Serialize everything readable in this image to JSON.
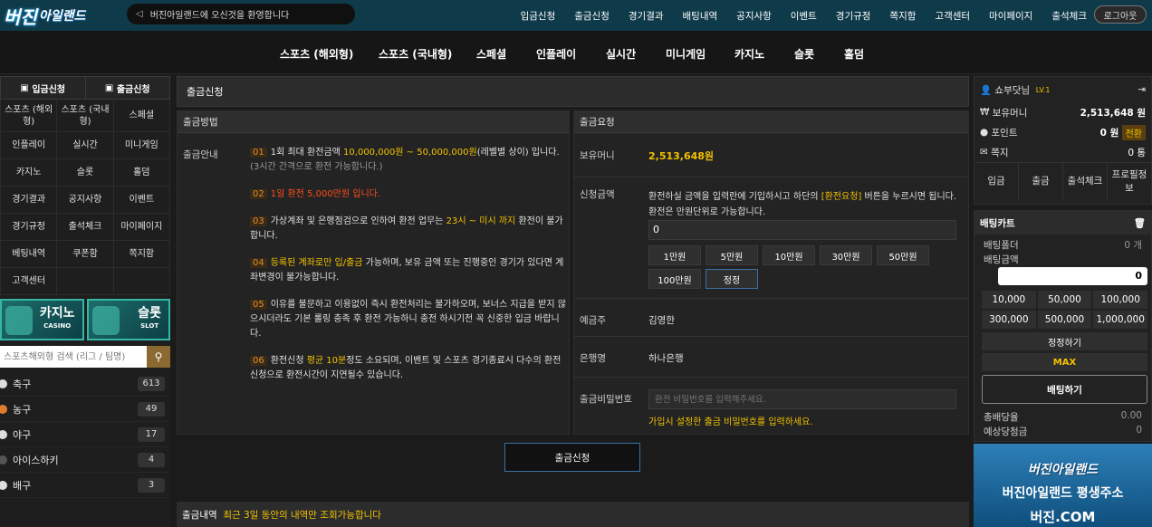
{
  "brand": {
    "logo_main": "버진",
    "logo_sub": "아일랜드"
  },
  "marquee": "버진아일랜드에 오신것을 환영합니다",
  "topnav": [
    "입금신청",
    "출금신청",
    "경기결과",
    "배팅내역",
    "공지사항",
    "이벤트",
    "경기규정",
    "쪽지함",
    "고객센터",
    "마이페이지",
    "출석체크"
  ],
  "logout": "로그아웃",
  "mainnav": [
    "스포츠 (해외형)",
    "스포츠 (국내형)",
    "스페셜",
    "인플레이",
    "실시간",
    "미니게임",
    "카지노",
    "슬롯",
    "홀덤"
  ],
  "left": {
    "tabs": [
      "입금신청",
      "출금신청"
    ],
    "menu": [
      "스포츠 (해외형)",
      "스포츠 (국내형)",
      "스페셜",
      "인플레이",
      "실시간",
      "미니게임",
      "카지노",
      "슬롯",
      "홀덤",
      "경기결과",
      "공지사항",
      "이벤트",
      "경기규정",
      "출석체크",
      "마이페이지",
      "베팅내역",
      "쿠폰함",
      "쪽지함",
      "고객센터"
    ],
    "banners": [
      {
        "title": "카지노",
        "sub": "CASINO"
      },
      {
        "title": "슬롯",
        "sub": "SLOT"
      }
    ],
    "search_placeholder": "스포츠해외형 검색 (리그 / 팀명)",
    "sports": [
      {
        "name": "축구",
        "count": "613"
      },
      {
        "name": "농구",
        "count": "49"
      },
      {
        "name": "야구",
        "count": "17"
      },
      {
        "name": "아이스하키",
        "count": "4"
      },
      {
        "name": "배구",
        "count": "3"
      }
    ]
  },
  "center": {
    "title": "출금신청",
    "method_title": "출금방법",
    "guide_label": "출금안내",
    "notes": [
      {
        "num": "01",
        "pre": "1회 최대 환전금액 ",
        "hl": "10,000,000원 ~ 50,000,000원",
        "post": "(레벨별 상이) 입니다.",
        "sub": "(3시간 간격으로 환전 가능합니다.)"
      },
      {
        "num": "02",
        "red": "1일 환전 5,000만원 입니다."
      },
      {
        "num": "03",
        "pre": "가상계좌 및 은행점검으로 인하여 환전 업무는 ",
        "hl": "23시 ~ 미시 까지",
        "post": " 환전이 불가합니다."
      },
      {
        "num": "04",
        "hl": "등록된 계좌로만 입/출금",
        "post": " 가능하며, 보유 금액 또는 진행중인 경기가 있다면 계좌변경이 불가능합니다."
      },
      {
        "num": "05",
        "pre": "",
        "post": "이유를 불문하고 이용없이 즉시 환전처리는 불가하오며, 보너스 지급을 받지 않으시더라도 기본 롤링 충족 후 환전 가능하니 충전 하시기전 꼭 신중한 입금 바랍니다."
      },
      {
        "num": "06",
        "pre": "환전신청 ",
        "hl": "평균 10분",
        "post": "정도 소요되며, 이벤트 및 스포츠 경기종료시 다수의 환전신청으로 환전시간이 지연될수 있습니다."
      }
    ],
    "request_title": "출금요청",
    "balance_label": "보유머니",
    "balance_value": "2,513,648원",
    "amount_label": "신청금액",
    "amount_desc_pre": "환전하실 금액을 입력란에 기입하시고 하단의 ",
    "amount_desc_hl": "[환전요청]",
    "amount_desc_post": " 버튼을 누르시면 됩니다.",
    "amount_desc2": "환전은 만원단위로 가능합니다.",
    "amount_value": "0",
    "amount_buttons": [
      "1만원",
      "5만원",
      "10만원",
      "30만원",
      "50만원",
      "100만원",
      "정정"
    ],
    "holder_label": "예금주",
    "holder_value": "김영한",
    "bank_label": "은행명",
    "bank_value": "하나은행",
    "pw_label": "출금비밀번호",
    "pw_placeholder": "환전 비밀번호를 입력해주세요.",
    "pw_note": "가입시 설정한 출금 비밀번호를 입력하세요.",
    "submit": "출금신청",
    "history_label": "출금내역",
    "history_note": "최근 3일 동안의 내역만 조회가능합니다"
  },
  "right": {
    "user": "쇼부닷님",
    "level": "LV.1",
    "money_label": "보유머니",
    "money_value": "2,513,648 원",
    "point_label": "포인트",
    "point_value": "0 원",
    "point_btn": "전환",
    "msg_label": "쪽지",
    "msg_value": "0 통",
    "actions": [
      "입금",
      "출금",
      "출석체크",
      "프로필정보"
    ],
    "cart_title": "배팅카트",
    "folder_label": "배팅폴더",
    "folder_value": "0 개",
    "bet_amount_label": "배팅금액",
    "bet_amount_value": "0",
    "chips": [
      "10,000",
      "50,000",
      "100,000",
      "300,000",
      "500,000",
      "1,000,000"
    ],
    "reset": "정정하기",
    "max": "MAX",
    "bet_btn": "배팅하기",
    "total_odds_label": "총배당율",
    "total_odds_value": "0.00",
    "expected_label": "예상당첨금",
    "expected_value": "0"
  },
  "ad": {
    "logo": "버진아일랜드",
    "line1": "버진아일랜드 평생주소",
    "line2": "버진.COM"
  },
  "colors": {
    "accent": "#f2c200",
    "top_bar": "#0f3a4a",
    "banner_border": "#35b7a5"
  }
}
